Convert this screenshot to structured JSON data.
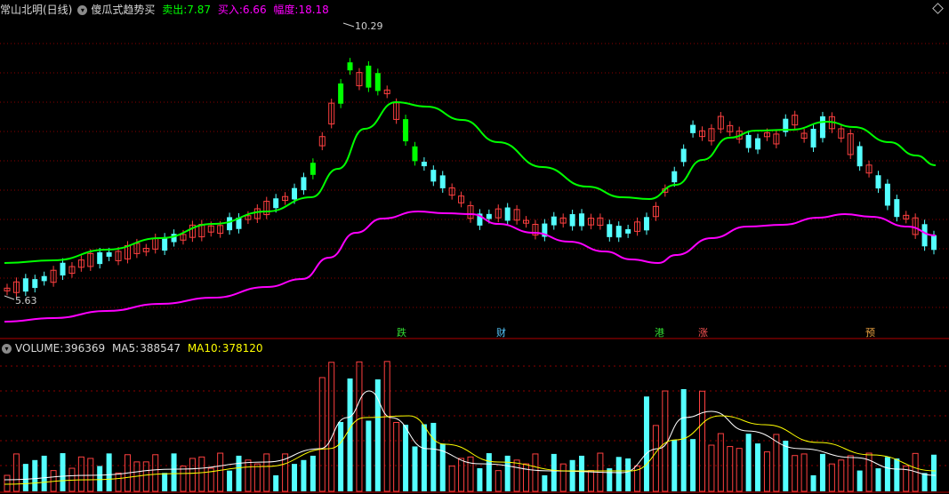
{
  "header": {
    "stock_name": "常山北明(日线)",
    "indicator_name": "傻瓜式趋势买",
    "sell_label": "卖出:",
    "sell_value": "7.87",
    "buy_label": "买入:",
    "buy_value": "6.66",
    "amp_label": "幅度:",
    "amp_value": "18.18"
  },
  "volume_header": {
    "vol_label": "VOLUME:",
    "vol_value": "396369",
    "ma5_label": "MA5:",
    "ma5_value": "388547",
    "ma10_label": "MA10:",
    "ma10_value": "378120"
  },
  "price_labels": {
    "high": "10.29",
    "low": "5.63"
  },
  "markers": [
    {
      "text": "跌",
      "color": "#33dd33"
    },
    {
      "text": "财",
      "color": "#55c8ff"
    },
    {
      "text": "港",
      "color": "#33dd33"
    },
    {
      "text": "涨",
      "color": "#ff5555"
    },
    {
      "text": "预",
      "color": "#e8a040"
    }
  ],
  "colors": {
    "background": "#000000",
    "up_candle": "#ff4040",
    "down_candle": "#54ffff",
    "trend_green": "#00ff00",
    "trend_magenta": "#ff00ff",
    "ma5": "#ffffff",
    "ma10": "#ffff00",
    "grid": "#8b0000",
    "sell_text": "#00ff00",
    "buy_text": "#ff00ff",
    "amp_text": "#ff00ff"
  }
}
